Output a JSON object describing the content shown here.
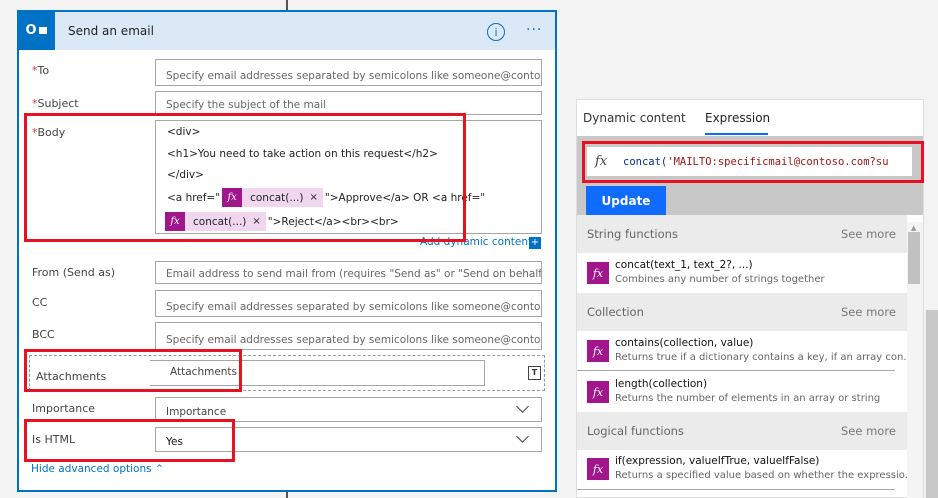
{
  "card": {
    "title": "Send an email",
    "icon_text": "O"
  },
  "fields": {
    "to": {
      "label": "To",
      "required_mark": "*",
      "placeholder": "Specify email addresses separated by semicolons like someone@contoso.com"
    },
    "subject": {
      "label": "Subject",
      "required_mark": "*",
      "placeholder": "Specify the subject of the mail"
    },
    "body": {
      "label": "Body",
      "required_mark": "*",
      "lines": [
        "<div>",
        "<h1>You need to take action on this request</h2>",
        "</div>"
      ],
      "line4_pre": "<a href=\"",
      "line4_token": "concat(...)",
      "line4_post": "\">Approve</a> OR <a href=\"",
      "line5_token": "concat(...)",
      "line5_post": "\">Reject</a><br><br>",
      "token_close": "×"
    },
    "add_dynamic": "Add dynamic content",
    "from": {
      "label": "From (Send as)",
      "placeholder": "Email address to send mail from (requires \"Send as\" or \"Send on behalf of\""
    },
    "cc": {
      "label": "CC",
      "placeholder": "Specify email addresses separated by semicolons like someone@contoso.com"
    },
    "bcc": {
      "label": "BCC",
      "placeholder": "Specify email addresses separated by semicolons like someone@contoso.com"
    },
    "attachments": {
      "label": "Attachments",
      "placeholder": "Attachments"
    },
    "importance": {
      "label": "Importance",
      "value": "Importance"
    },
    "is_html": {
      "label": "Is HTML",
      "value": "Yes"
    },
    "hide_advanced": "Hide advanced options"
  },
  "panel": {
    "tabs": [
      "Dynamic content",
      "Expression"
    ],
    "active_tab": "Expression",
    "expression": "concat('MAILTO:specificmail@contoso.com?su",
    "expr_fn": "concat(",
    "expr_str": "'MAILTO:specificmail@contoso.com?su",
    "update": "Update",
    "see_more": "See more",
    "sections": [
      {
        "name": "String functions",
        "items": [
          {
            "fn": "concat(text_1, text_2?, ...)",
            "desc": "Combines any number of strings together"
          }
        ]
      },
      {
        "name": "Collection",
        "items": [
          {
            "fn": "contains(collection, value)",
            "desc": "Returns true if a dictionary contains a key, if an array con..."
          },
          {
            "fn": "length(collection)",
            "desc": "Returns the number of elements in an array or string"
          }
        ]
      },
      {
        "name": "Logical functions",
        "items": [
          {
            "fn": "if(expression, valueIfTrue, valueIfFalse)",
            "desc": "Returns a specified value based on whether the expressio..."
          }
        ]
      }
    ]
  },
  "colors": {
    "accent": "#0072c6",
    "function": "#a2168d",
    "update": "#0f6cff",
    "highlight": "#e81123"
  }
}
